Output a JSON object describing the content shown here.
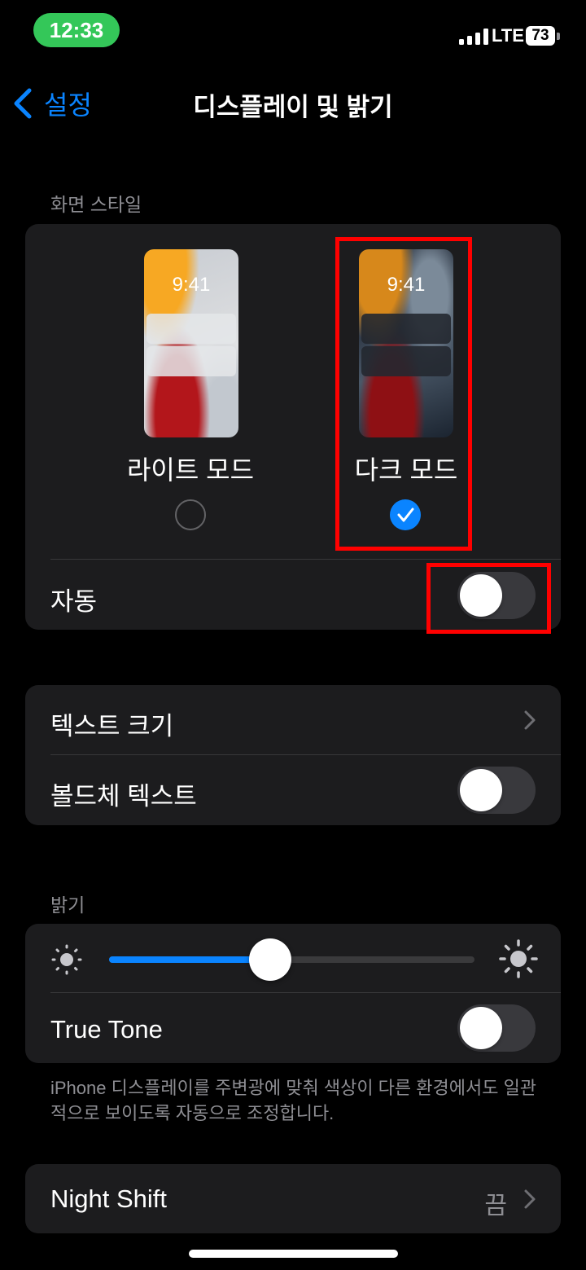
{
  "status": {
    "time": "12:33",
    "network": "LTE",
    "battery": "73"
  },
  "nav": {
    "back_label": "설정",
    "title": "디스플레이 및 밝기"
  },
  "appearance": {
    "section_label": "화면 스타일",
    "light": {
      "clock": "9:41",
      "label": "라이트 모드",
      "selected": false
    },
    "dark": {
      "clock": "9:41",
      "label": "다크 모드",
      "selected": true
    },
    "auto_label": "자동",
    "auto_on": false
  },
  "text": {
    "text_size_label": "텍스트 크기",
    "bold_text_label": "볼드체 텍스트",
    "bold_text_on": false
  },
  "brightness": {
    "section_label": "밝기",
    "level": 0.44,
    "true_tone_label": "True Tone",
    "true_tone_on": false,
    "footnote": "iPhone 디스플레이를 주변광에 맞춰 색상이 다른 환경에서도 일관적으로 보이도록 자동으로 조정합니다."
  },
  "night_shift": {
    "label": "Night Shift",
    "value": "끔"
  },
  "colors": {
    "accent": "#0a84ff",
    "status_pill": "#34c759",
    "highlight": "#ff0000"
  }
}
